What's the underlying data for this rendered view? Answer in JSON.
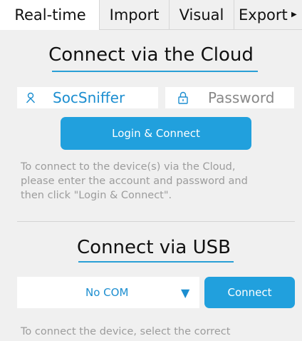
{
  "tabs": [
    {
      "label": "Real-time",
      "active": true
    },
    {
      "label": "Import",
      "active": false
    },
    {
      "label": "Visual",
      "active": false
    },
    {
      "label": "Export",
      "active": false
    }
  ],
  "cloud": {
    "title": "Connect via the Cloud",
    "username_value": "SocSniffer",
    "password_placeholder": "Password",
    "login_button": "Login & Connect",
    "help_lines": [
      "To connect to the device(s) via the Cloud,",
      "please enter the account and password and",
      "then click \"Login & Connect\"."
    ]
  },
  "usb": {
    "title": "Connect via USB",
    "com_select_value": "No COM",
    "connect_button": "Connect",
    "help_lines": [
      "To connect the device, select the correct"
    ]
  },
  "colors": {
    "accent": "#21a0dd",
    "accent_text": "#1c8ed0",
    "help_text": "#9c9c9c",
    "panel_bg": "#f0f0f0"
  },
  "icons": {
    "user": "user-icon",
    "lock": "lock-icon",
    "dropdown": "caret-down-icon",
    "tab_overflow": "tab-overflow-icon"
  }
}
